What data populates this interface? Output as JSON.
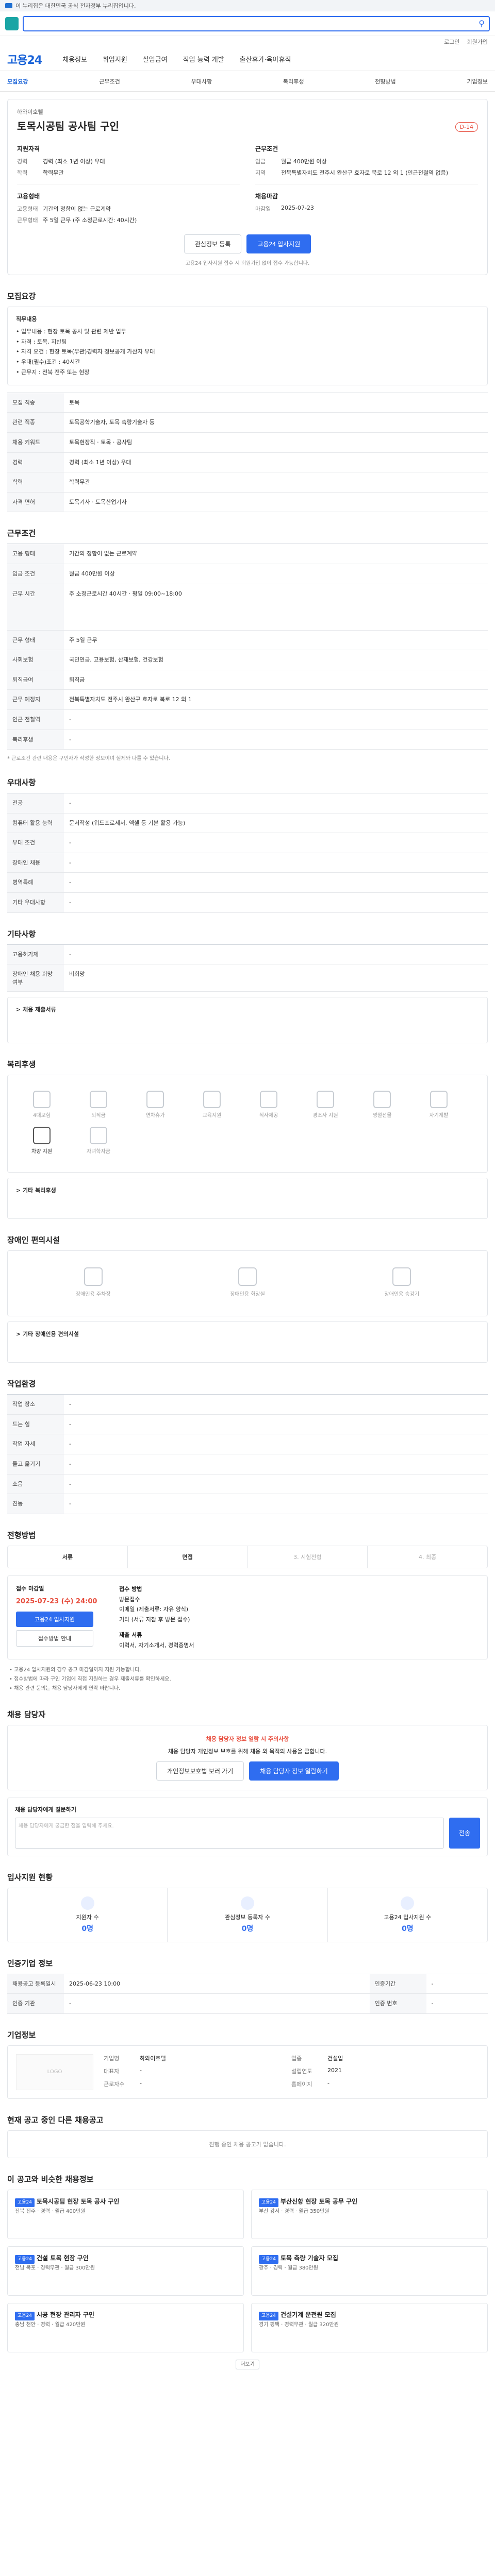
{
  "topbar": {
    "text": "이 누리집은 대한민국 공식 전자정부 누리집입니다."
  },
  "util": {
    "links": [
      "로그인",
      "회원가입"
    ]
  },
  "gnb": {
    "brand": "고용24",
    "items": [
      "채용정보",
      "취업지원",
      "실업급여",
      "직업 능력 개발",
      "출산휴가·육아휴직"
    ]
  },
  "subtabs": [
    "모집요강",
    "근무조건",
    "우대사항",
    "복리후생",
    "전형방법",
    "기업정보"
  ],
  "header": {
    "company": "하와이호텔",
    "title": "토목시공팀 공사팀 구인",
    "dday": "D-14",
    "left_title": "지원자격",
    "left_kv": [
      {
        "k": "경력",
        "v": "경력 (최소 1년 이상) 우대"
      },
      {
        "k": "학력",
        "v": "학력무관"
      }
    ],
    "left_title2": "고용형태",
    "left_kv2": [
      {
        "k": "고용형태",
        "v": "기간의 정함이 없는 근로계약"
      },
      {
        "k": "근무형태",
        "v": "주 5일 근무 (주 소정근로시간: 40시간)"
      }
    ],
    "right_title": "근무조건",
    "right_kv": [
      {
        "k": "임금",
        "v": "월급 400만원 이상"
      },
      {
        "k": "지역",
        "v": "전북특별자치도 전주시 완산구 효자로 북로 12 외 1 (인근전철역 없음)"
      }
    ],
    "right_title2": "채용마감",
    "right_kv2": [
      {
        "k": "마감일",
        "v": "2025-07-23"
      }
    ],
    "btn_scrap": "관심정보 등록",
    "btn_apply": "고용24 입사지원",
    "note": "고용24 입사지원 접수 시 회원가입 없이 접수 가능합니다."
  },
  "recruit": {
    "heading": "모집요강",
    "box_title": "직무내용",
    "lines": [
      "• 업무내용 : 현장 토목 공사 및 관련 제반 업무",
      "• 자격 : 토목, 지반팀",
      "• 자격 요건 : 현장 토목(무관)경력자 정보공개 가산자 우대",
      "• 우대(필수)조건 : 40시간",
      "• 근무지 : 전북 전주 또는 현장"
    ],
    "rows": [
      {
        "k": "모집 직종",
        "v": "토목"
      },
      {
        "k": "관련 직종",
        "v": "토목공학기술자, 토목 측량기술자 등"
      },
      {
        "k": "채용 키워드",
        "v": "토목현장직 · 토목 · 공사팀"
      },
      {
        "k": "경력",
        "v": "경력 (최소 1년 이상) 우대"
      },
      {
        "k": "학력",
        "v": "학력무관"
      },
      {
        "k": "자격 면허",
        "v": "토목기사 · 토목산업기사"
      }
    ]
  },
  "work": {
    "heading": "근무조건",
    "rows": [
      {
        "k": "고용 형태",
        "v": "기간의 정함이 없는 근로계약"
      },
      {
        "k": "임금 조건",
        "v": "월급 400만원 이상"
      },
      {
        "k": "근무 시간",
        "v": "주 소정근로시간 40시간 · 평일 09:00~18:00"
      },
      {
        "k": "근무 형태",
        "v": "주 5일 근무"
      },
      {
        "k": "사회보험",
        "v": "국민연금, 고용보험, 산재보험, 건강보험"
      },
      {
        "k": "퇴직급여",
        "v": "퇴직금"
      },
      {
        "k": "근무 예정지",
        "v": "전북특별자치도 전주시 완산구 효자로 북로 12 외 1"
      },
      {
        "k": "인근 전철역",
        "v": "-"
      },
      {
        "k": "복리후생",
        "v": "-"
      }
    ],
    "note": "* 근로조건 관련 내용은 구인자가 작성한 정보이며 실제와 다를 수 있습니다."
  },
  "pref": {
    "heading": "우대사항",
    "rows": [
      {
        "k": "전공",
        "v": "-"
      },
      {
        "k": "컴퓨터 활용 능력",
        "v": "문서작성 (워드프로세서, 엑셀 등 기본 활용 가능)"
      },
      {
        "k": "우대 조건",
        "v": "-"
      },
      {
        "k": "장애인 채용",
        "v": "-"
      },
      {
        "k": "병역특례",
        "v": "-"
      },
      {
        "k": "기타 우대사항",
        "v": "-"
      }
    ]
  },
  "other": {
    "heading": "기타사항",
    "rows": [
      {
        "k": "고용허가제",
        "v": "-"
      },
      {
        "k": "장애인 채용 희망 여부",
        "v": "비희망"
      }
    ],
    "sub": "> 채용 제출서류"
  },
  "welfare": {
    "heading": "복리후생",
    "items": [
      "4대보험",
      "퇴직금",
      "연차휴가",
      "교육지원",
      "식사제공",
      "경조사 지원",
      "명절선물",
      "자기계발",
      "차량 지원",
      "자녀학자금"
    ],
    "active_index": 8,
    "sub": "> 기타 복리후생"
  },
  "disab": {
    "heading": "장애인 편의시설",
    "items": [
      "장애인용 주차장",
      "장애인용 화장실",
      "장애인용 승강기"
    ],
    "sub": "> 기타 장애인용 편의시설"
  },
  "worksite": {
    "heading": "작업환경",
    "rows": [
      {
        "k": "작업 장소",
        "v": "-"
      },
      {
        "k": "드는 힘",
        "v": "-"
      },
      {
        "k": "작업 자세",
        "v": "-"
      },
      {
        "k": "들고 옮기기",
        "v": "-"
      },
      {
        "k": "소음",
        "v": "-"
      },
      {
        "k": "진동",
        "v": "-"
      }
    ]
  },
  "process": {
    "heading": "전형방법",
    "steps": [
      "서류",
      "면접",
      "3. 시험전형",
      "4. 최종"
    ],
    "active": [
      0,
      1
    ],
    "apply_title": "접수 마감일",
    "apply_date": "2025-07-23 (수) 24:00",
    "apply_btn": "고용24 입사지원",
    "apply_btn2": "접수방법 안내",
    "right_title": "접수 방법",
    "right_lines": [
      "방문접수",
      "이메일 (제출서류: 자유 양식)",
      "기타 (서류 지참 후 방문 접수)"
    ],
    "right_title2": "제출 서류",
    "right_lines2": [
      "이력서, 자기소개서, 경력증명서"
    ],
    "bullets": [
      "• 고용24 입사지원의 경우 공고 마감일까지 지원 가능합니다.",
      "• 접수방법에 따라 구인 기업에 직접 지원하는 경우 제출서류를 확인하세요.",
      "• 채용 관련 문의는 채용 담당자에게 연락 바랍니다."
    ]
  },
  "contact": {
    "heading": "채용 담당자",
    "warn_red": "채용 담당자 정보 열람 시 주의사항",
    "warn_text": "채용 담당자 개인정보 보호를 위해 채용 외 목적의 사용을 금합니다.",
    "btn1": "개인정보보호법 보러 가기",
    "btn2": "채용 담당자 정보 열람하기",
    "inq_title": "채용 담당자에게 질문하기",
    "inq_placeholder": "채용 담당자에게 궁금한 점을 입력해 주세요.",
    "inq_btn": "전송"
  },
  "status": {
    "heading": "입사지원 현황",
    "cols": [
      {
        "label": "지원자 수",
        "n": "0명"
      },
      {
        "label": "관심정보 등록자 수",
        "n": "0명"
      },
      {
        "label": "고용24 입사지원 수",
        "n": "0명"
      }
    ]
  },
  "cert": {
    "heading": "인증기업 정보",
    "rows": [
      {
        "k": "채용공고 등록일시",
        "v": "2025-06-23 10:00"
      },
      {
        "k": "인증기간",
        "v": "-"
      },
      {
        "k": "인증 기관",
        "v": "-"
      },
      {
        "k": "인증 번호",
        "v": "-"
      }
    ]
  },
  "corp": {
    "heading": "기업정보",
    "logo": "LOGO",
    "grid": [
      {
        "k": "기업명",
        "v": "하와이호텔"
      },
      {
        "k": "업종",
        "v": "건설업"
      },
      {
        "k": "대표자",
        "v": "-"
      },
      {
        "k": "설립연도",
        "v": "2021"
      },
      {
        "k": "근로자수",
        "v": "-"
      },
      {
        "k": "홈페이지",
        "v": "-"
      }
    ]
  },
  "same": {
    "heading": "현재 공고 중인 다른 채용공고",
    "empty": "진행 중인 채용 공고가 없습니다."
  },
  "similar": {
    "heading": "이 공고와 비슷한 채용정보",
    "cards": [
      {
        "badge": "고용24",
        "ttl": "토목시공팀 현장 토목 공사 구인",
        "meta": "전북 전주 · 경력 · 월급 400만원"
      },
      {
        "badge": "고용24",
        "ttl": "부산신항 현장 토목 공무 구인",
        "meta": "부산 강서 · 경력 · 월급 350만원"
      },
      {
        "badge": "고용24",
        "ttl": "건설 토목 현장 구인",
        "meta": "전남 목포 · 경력무관 · 월급 300만원"
      },
      {
        "badge": "고용24",
        "ttl": "토목 측량 기술자 모집",
        "meta": "광주 · 경력 · 월급 380만원"
      },
      {
        "badge": "고용24",
        "ttl": "시공 현장 관리자 구인",
        "meta": "충남 천안 · 경력 · 월급 420만원"
      },
      {
        "badge": "고용24",
        "ttl": "건설기계 운전원 모집",
        "meta": "경기 평택 · 경력무관 · 월급 320만원"
      }
    ],
    "more": "더보기"
  },
  "colors": {
    "primary": "#2f6df0",
    "danger": "#e74c3c"
  }
}
